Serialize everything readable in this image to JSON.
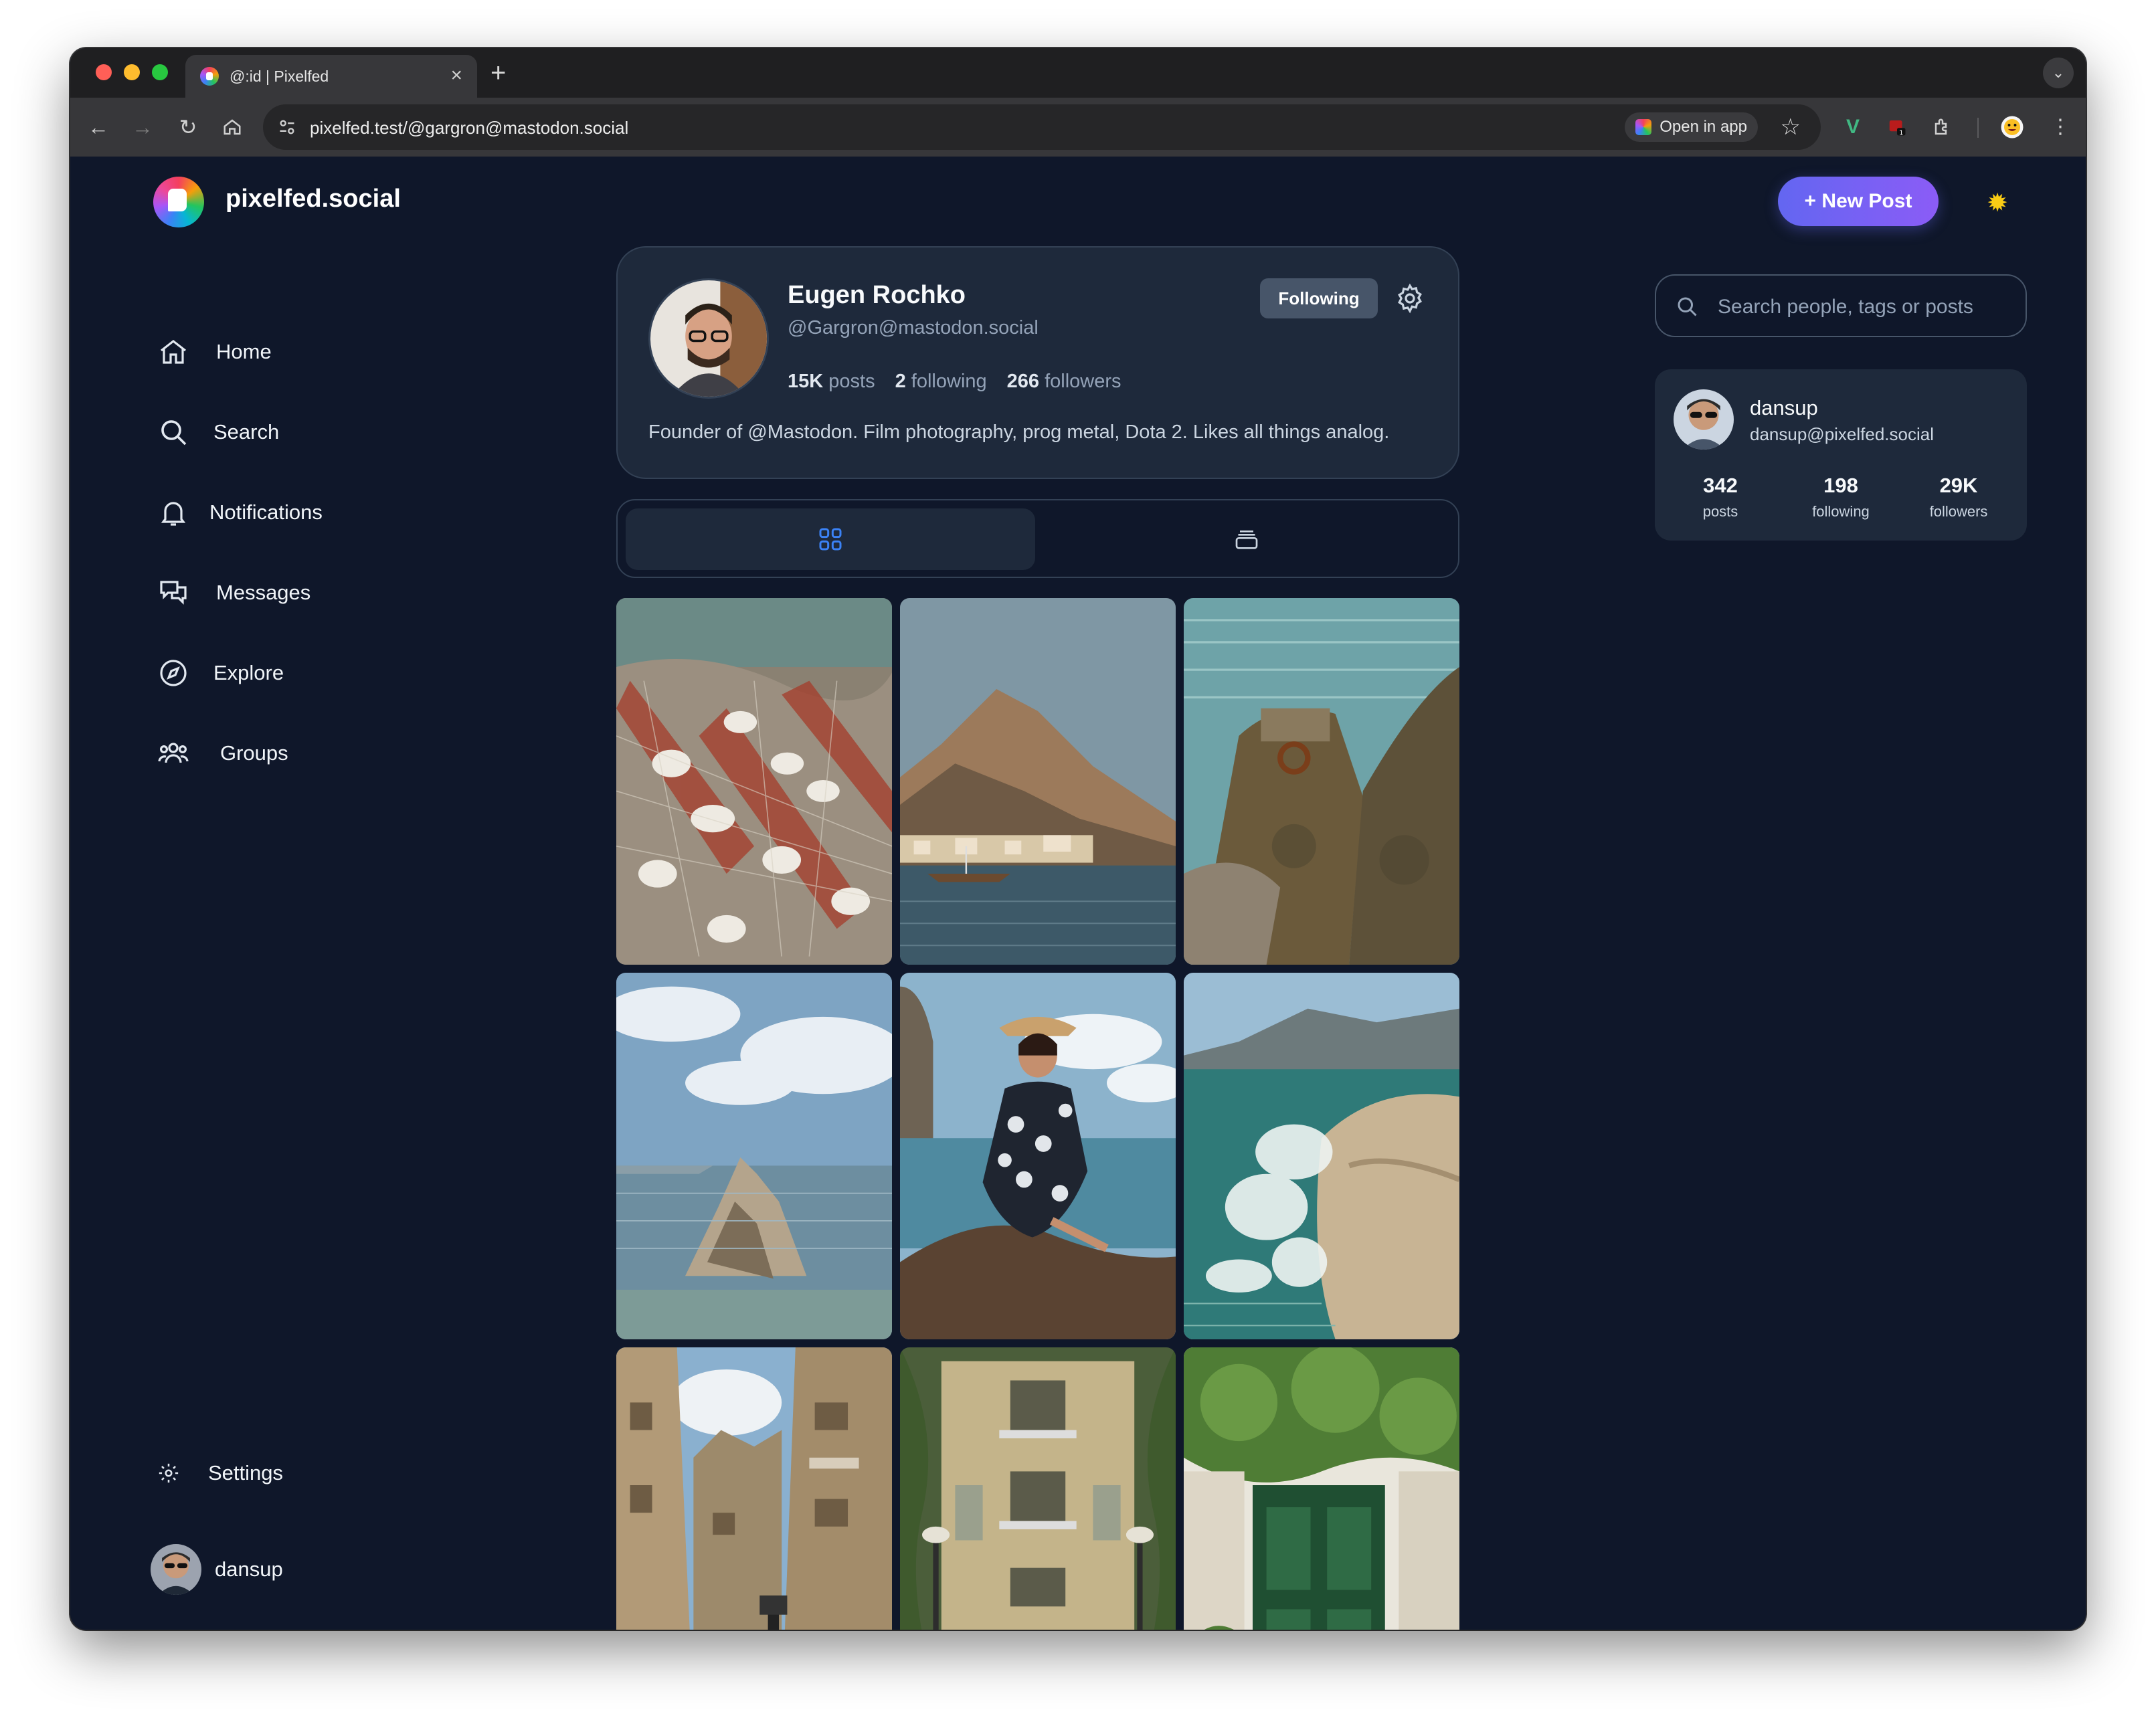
{
  "browser": {
    "tab_title": "@:id | Pixelfed",
    "url": "pixelfed.test/@gargron@mastodon.social",
    "open_in_app": "Open in app",
    "ext_badge": "1"
  },
  "app": {
    "brand": "pixelfed.social",
    "new_post": "New Post"
  },
  "nav": [
    {
      "label": "Home",
      "icon": "home-icon"
    },
    {
      "label": "Search",
      "icon": "search-icon"
    },
    {
      "label": "Notifications",
      "icon": "bell-icon"
    },
    {
      "label": "Messages",
      "icon": "chat-icon"
    },
    {
      "label": "Explore",
      "icon": "compass-icon"
    },
    {
      "label": "Groups",
      "icon": "users-icon"
    }
  ],
  "settings_label": "Settings",
  "current_user": {
    "username": "dansup",
    "handle": "dansup@pixelfed.social",
    "stats": [
      {
        "value": "342",
        "label": "posts"
      },
      {
        "value": "198",
        "label": "following"
      },
      {
        "value": "29K",
        "label": "followers"
      }
    ]
  },
  "profile": {
    "name": "Eugen Rochko",
    "handle": "@Gargron@mastodon.social",
    "posts_count": "15K",
    "posts_label": "posts",
    "following_count": "2",
    "following_label": "following",
    "followers_count": "266",
    "followers_label": "followers",
    "follow_button": "Following",
    "bio": "Founder of @Mastodon. Film photography, prog metal, Dota 2. Likes all things analog."
  },
  "search": {
    "placeholder": "Search people, tags or posts"
  },
  "colors": {
    "background": "#0f172a",
    "card": "#1e293b",
    "accent": "#6366f1",
    "active_tab_icon": "#3b82f6"
  },
  "photos": [
    "fishing nets",
    "coastal town with mountains",
    "rocks with rusty ring",
    "rock islet in sea",
    "woman in hat sitting on rock",
    "waves crashing on rock",
    "narrow old town street",
    "yellow building with balconies",
    "green door with vines"
  ]
}
